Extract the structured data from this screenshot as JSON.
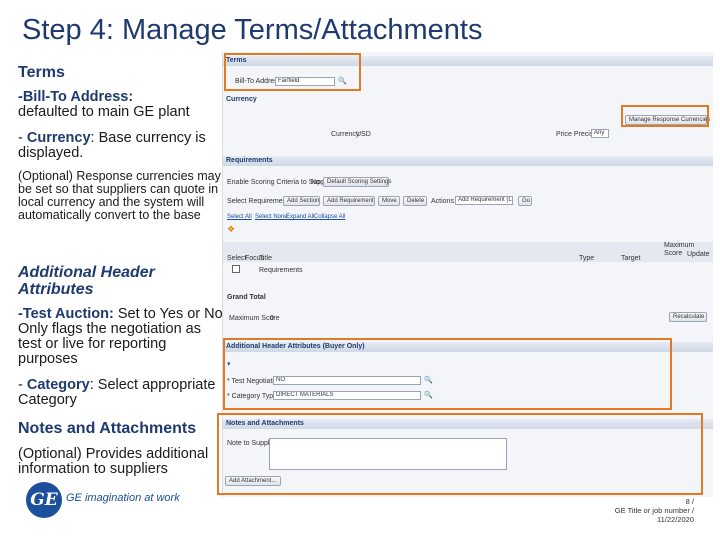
{
  "slide": {
    "title": "Step 4: Manage Terms/Attachments",
    "terms_heading": "Terms",
    "bill_to_label": "-Bill-To Address:",
    "bill_to_text": "defaulted to main GE plant",
    "currency_dash": "- ",
    "currency_label": "Currency",
    "currency_text": ": Base currency is displayed.",
    "optional_currency_text": "(Optional) Response currencies may be set so that suppliers can quote in local currency and the system will automatically convert to the base",
    "aha_heading": "Additional Header Attributes",
    "test_auction_label": "-Test Auction:",
    "test_auction_text": " Set to Yes or No. Only flags the negotiation as test or live for reporting purposes",
    "category_dash": "- ",
    "category_label": "Category",
    "category_text": ": Select appropriate Category",
    "notes_heading": "Notes and Attachments",
    "notes_text": "(Optional) Provides additional information to suppliers",
    "logo_mark": "GE",
    "logo_text": "GE imagination at work",
    "footer_page": "8 /",
    "footer_title": "GE Title or job number /",
    "footer_date": "11/22/2020"
  },
  "screenshot": {
    "terms_bar": "Terms",
    "bill_to_label": "Bill-To Address",
    "bill_to_value": "Fairfield",
    "currency_section": "Currency",
    "manage_currencies_button": "Manage Response Currencies",
    "currency_label": "Currency",
    "currency_value": "USD",
    "price_precision_label": "Price Precision",
    "price_precision_value": "Any",
    "requirements_bar": "Requirements",
    "enable_scoring_label": "Enable Scoring Criteria to Suppliers",
    "enable_scoring_value": "No",
    "scoring_settings_button": "Default Scoring Settings",
    "select_requirement_label": "Select Requirement:",
    "add_section_button": "Add Section",
    "add_requirement_button": "Add Requirement",
    "move_button": "Move",
    "delete_button": "Delete",
    "actions_label": "Actions",
    "actions_value": "Add Requirement (List)",
    "go_button": "Go",
    "link_select_all": "Select All",
    "link_select_none": "Select None",
    "link_expand_all": "Expand All",
    "link_collapse_all": "Collapse All",
    "col_select": "Select",
    "col_focus": "Focus",
    "col_title": "Title",
    "col_type": "Type",
    "col_target": "Target",
    "col_max_score": "Maximum Score",
    "col_update": "Update",
    "row_requirements": "Requirements",
    "grand_total_label": "Grand Total",
    "max_score_label": "Maximum Score",
    "max_score_value": "0",
    "recalculate_button": "Recalculate",
    "aha_bar": "Additional Header Attributes (Buyer Only)",
    "test_negotiation_label": "* Test Negotiation",
    "test_negotiation_value": "NO",
    "category_label": "* Category Type",
    "category_value": "DIRECT MATERIALS",
    "notes_bar": "Notes and Attachments",
    "note_to_suppliers_label": "Note to Suppliers",
    "add_attachment_button": "Add Attachment..."
  },
  "colors": {
    "title": "#1f3a6e",
    "highlight": "#e07a24",
    "logo": "#1c4f9c"
  },
  "icons": [
    "search-icon",
    "dropdown-arrow-icon",
    "expand-icon",
    "ge-logo"
  ]
}
